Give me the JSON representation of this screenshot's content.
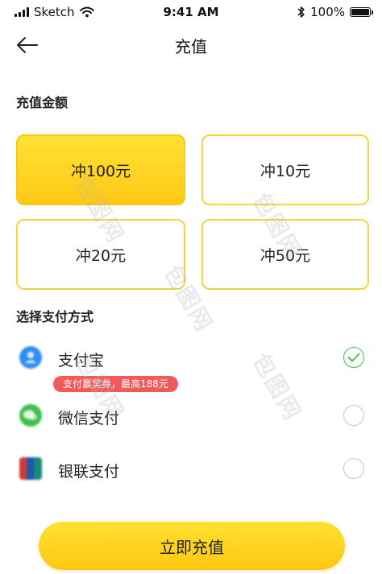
{
  "status_bar": {
    "carrier": "Sketch",
    "time": "9:41 AM",
    "battery": "100%",
    "battery_level": 1.0
  },
  "header": {
    "title": "充值",
    "back_icon": "arrow-left-icon"
  },
  "amount_section": {
    "title": "充值金额",
    "options": [
      {
        "label": "冲100元",
        "selected": true
      },
      {
        "label": "冲10元",
        "selected": false
      },
      {
        "label": "冲20元",
        "selected": false
      },
      {
        "label": "冲50元",
        "selected": false
      }
    ]
  },
  "payment_section": {
    "title": "选择支付方式",
    "methods": [
      {
        "label": "支付宝",
        "icon": "alipay-icon",
        "color": "#2e8ff0",
        "selected": true
      },
      {
        "label": "微信支付",
        "icon": "wechat-icon",
        "color": "#3fbf4a",
        "selected": false
      },
      {
        "label": "银联支付",
        "icon": "unionpay-icon",
        "color": "#d23a3a",
        "selected": false
      }
    ],
    "promo": "支付赢奖券，最高188元"
  },
  "confirm_button": {
    "label": "立即充值"
  },
  "watermark": {
    "text": "包图网"
  },
  "colors": {
    "accent_yellow": "#ffd21f",
    "check_green": "#45c452",
    "promo_red": "#f25a5a"
  }
}
